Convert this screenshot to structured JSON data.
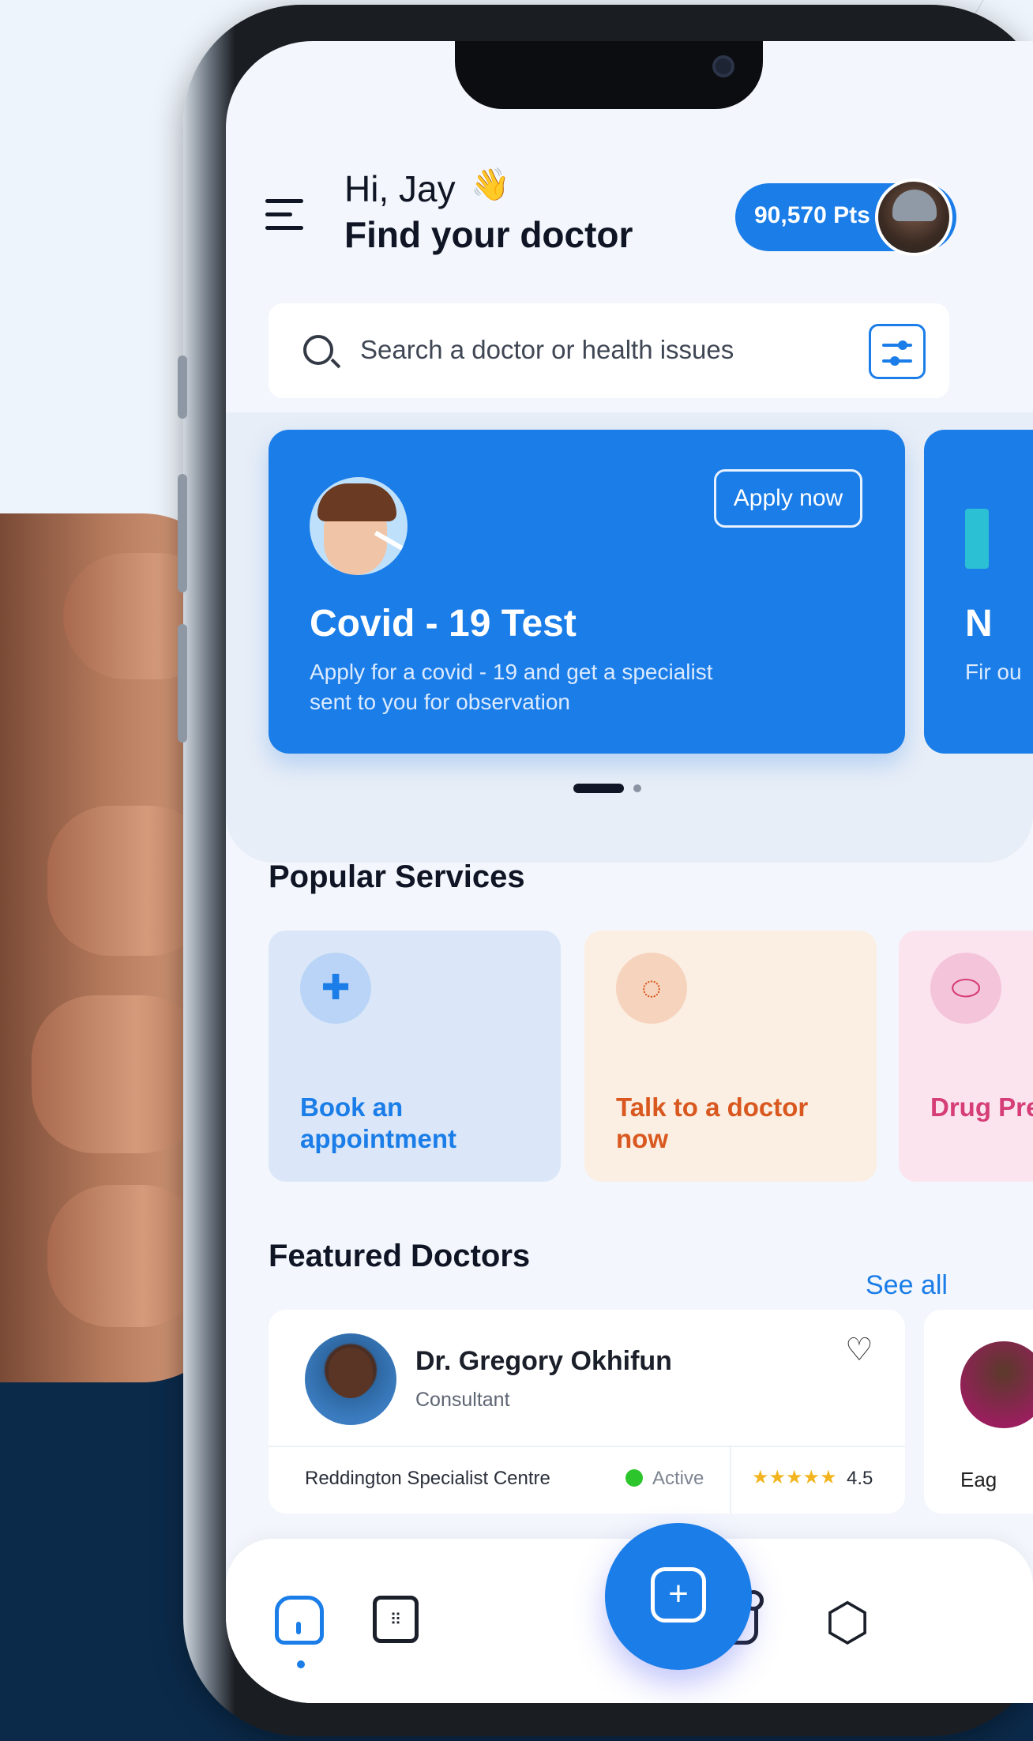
{
  "header": {
    "greeting": "Hi, Jay",
    "wave": "👋",
    "title": "Find your doctor",
    "points": "90,570 Pts"
  },
  "search": {
    "placeholder": "Search a doctor or health issues"
  },
  "promos": [
    {
      "title": "Covid - 19 Test",
      "description": "Apply for a covid - 19 and get a specialist sent to you for observation",
      "action": "Apply now"
    },
    {
      "title": "N",
      "description": "Fir ou"
    }
  ],
  "carousel": {
    "active_index": 0,
    "count": 2
  },
  "popular_services": {
    "title": "Popular Services",
    "items": [
      {
        "label": "Book an appointment",
        "icon": "cross-icon",
        "color": "#1a7de8"
      },
      {
        "label": "Talk to a doctor now",
        "icon": "chat-bubble-icon",
        "color": "#d9581f"
      },
      {
        "label": "Drug Pres",
        "icon": "pill-icon",
        "color": "#d63e78"
      }
    ]
  },
  "featured_doctors": {
    "title": "Featured Doctors",
    "see_all": "See all",
    "doctors": [
      {
        "name": "Dr. Gregory Okhifun",
        "role": "Consultant",
        "center": "Reddington Specialist Centre",
        "status": "Active",
        "stars": "★★★★★",
        "rating": "4.5"
      },
      {
        "center": "Eag"
      }
    ]
  },
  "nav": {
    "items": [
      "home-icon",
      "calendar-icon",
      "add-icon",
      "chat-icon",
      "settings-icon"
    ],
    "active": "home-icon"
  },
  "colors": {
    "accent": "#1a7de8",
    "orange": "#d9581f",
    "pink": "#d63e78",
    "status_active": "#2cc62c"
  }
}
